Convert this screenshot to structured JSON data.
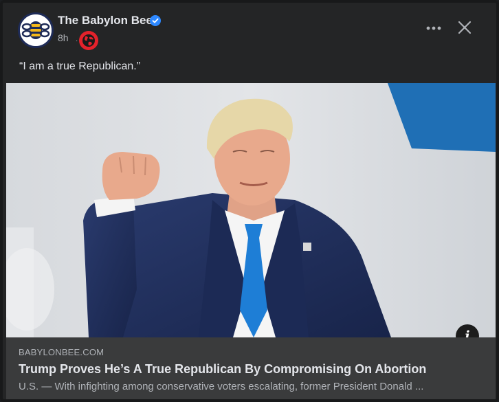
{
  "post": {
    "page_name": "The Babylon Bee",
    "time": "8h",
    "separator": "·",
    "caption": "“I am a true Republican.”",
    "icons": {
      "avatar": "babylon-bee-logo",
      "verified": "verified-badge-icon",
      "audience": "globe-icon",
      "more": "more-options-icon",
      "close": "close-icon",
      "info": "info-icon"
    }
  },
  "link": {
    "info_label": "i",
    "domain": "BABYLONBEE.COM",
    "title": "Trump Proves He’s A True Republican By Compromising On Abortion",
    "description": "U.S. — With infighting among conservative voters escalating, former President Donald ..."
  },
  "colors": {
    "card_bg": "#242526",
    "link_bg": "#3a3b3c",
    "primary_text": "#e4e6eb",
    "secondary_text": "#b0b3b8",
    "verified_blue": "#2d88ff",
    "globe_red": "#e4222b"
  }
}
